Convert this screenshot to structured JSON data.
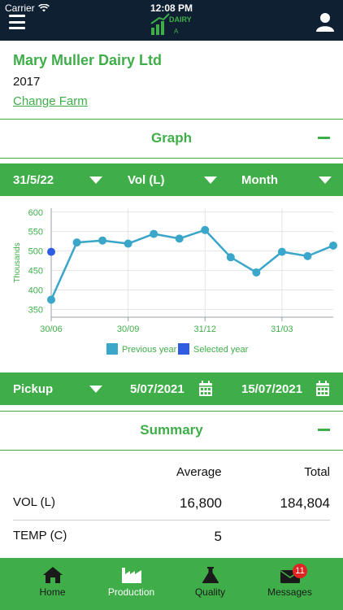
{
  "status": {
    "carrier": "Carrier",
    "time": "12:08 PM"
  },
  "header": {
    "logo_text": "DAIRY",
    "logo_sub": "A"
  },
  "farm": {
    "name": "Mary Muller Dairy Ltd",
    "year": "2017",
    "change_label": "Change Farm"
  },
  "graph_section": {
    "title": "Graph"
  },
  "graph_filters": {
    "date": "31/5/22",
    "measure": "Vol (L)",
    "period": "Month"
  },
  "chart_data": {
    "type": "line",
    "ylabel": "Thousands",
    "ylim": [
      330,
      610
    ],
    "yticks": [
      350,
      400,
      450,
      500,
      550,
      600
    ],
    "ytick_labels": [
      "350",
      "400",
      "450",
      "500",
      "550",
      "600"
    ],
    "xtick_labels": [
      "30/06",
      "30/09",
      "31/12",
      "31/03"
    ],
    "series": [
      {
        "name": "Previous year",
        "color": "#3aa6c9",
        "values": [
          375,
          522,
          527,
          519,
          544,
          532,
          554,
          484,
          445,
          498,
          487,
          514
        ]
      },
      {
        "name": "Selected year",
        "color": "#2f5ce0",
        "values": [
          498
        ]
      }
    ],
    "legend": [
      "Previous year",
      "Selected year"
    ],
    "legend_position": "bottom",
    "grid": true
  },
  "pickup_filters": {
    "type": "Pickup",
    "from_date": "5/07/2021",
    "to_date": "15/07/2021"
  },
  "summary_section": {
    "title": "Summary"
  },
  "summary": {
    "col_average": "Average",
    "col_total": "Total",
    "rows": [
      {
        "label": "VOL (L)",
        "average": "16,800",
        "total": "184,804"
      },
      {
        "label": "TEMP (C)",
        "average": "5",
        "total": ""
      }
    ]
  },
  "tabs": [
    {
      "label": "Home",
      "icon": "home-icon"
    },
    {
      "label": "Production",
      "icon": "factory-icon"
    },
    {
      "label": "Quality",
      "icon": "flask-icon"
    },
    {
      "label": "Messages",
      "icon": "mail-icon",
      "badge": "11"
    }
  ],
  "colors": {
    "brand_green": "#3fae49",
    "nav_dark": "#0f2033",
    "badge_red": "#e02424"
  }
}
